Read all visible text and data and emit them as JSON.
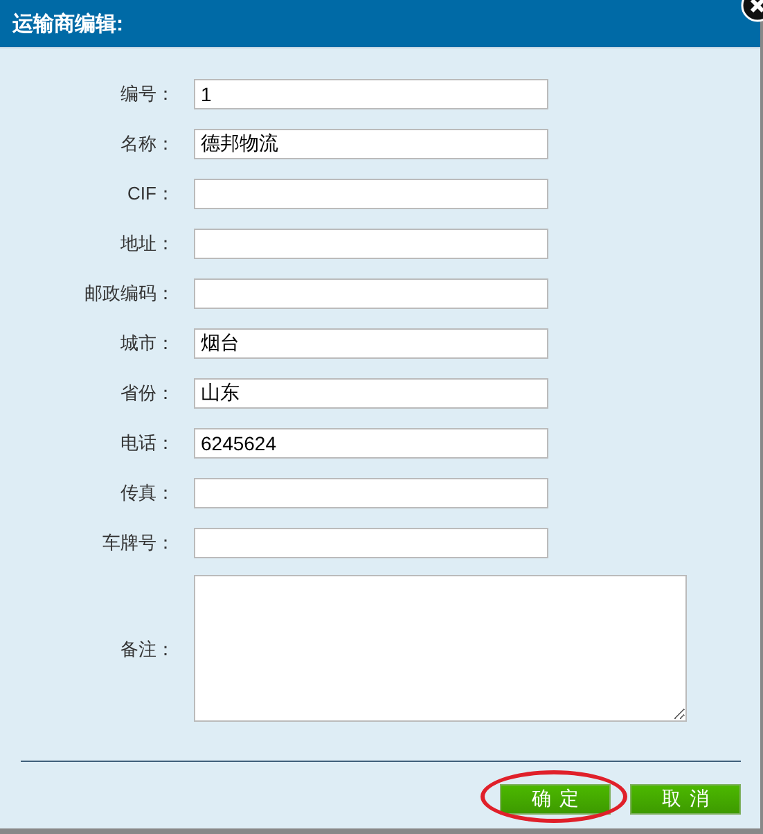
{
  "window": {
    "title": "运输商编辑:"
  },
  "fields": [
    {
      "label": "编号：",
      "value": "1",
      "kind": "text"
    },
    {
      "label": "名称：",
      "value": "德邦物流",
      "kind": "text"
    },
    {
      "label": "CIF：",
      "kind": "text"
    },
    {
      "label": "地址：",
      "kind": "text"
    },
    {
      "label": "邮政编码：",
      "kind": "text"
    },
    {
      "label": "城市：",
      "value": "烟台",
      "kind": "text"
    },
    {
      "label": "省份：",
      "value": "山东",
      "kind": "text"
    },
    {
      "label": "电话：",
      "value": "6245624",
      "kind": "text"
    },
    {
      "label": "传真：",
      "kind": "text"
    },
    {
      "label": "车牌号：",
      "kind": "text"
    },
    {
      "label": "备注：",
      "kind": "textarea"
    }
  ],
  "buttons": [
    {
      "label": "确定",
      "highlighted": true
    },
    {
      "label": "取消",
      "highlighted": false
    }
  ]
}
